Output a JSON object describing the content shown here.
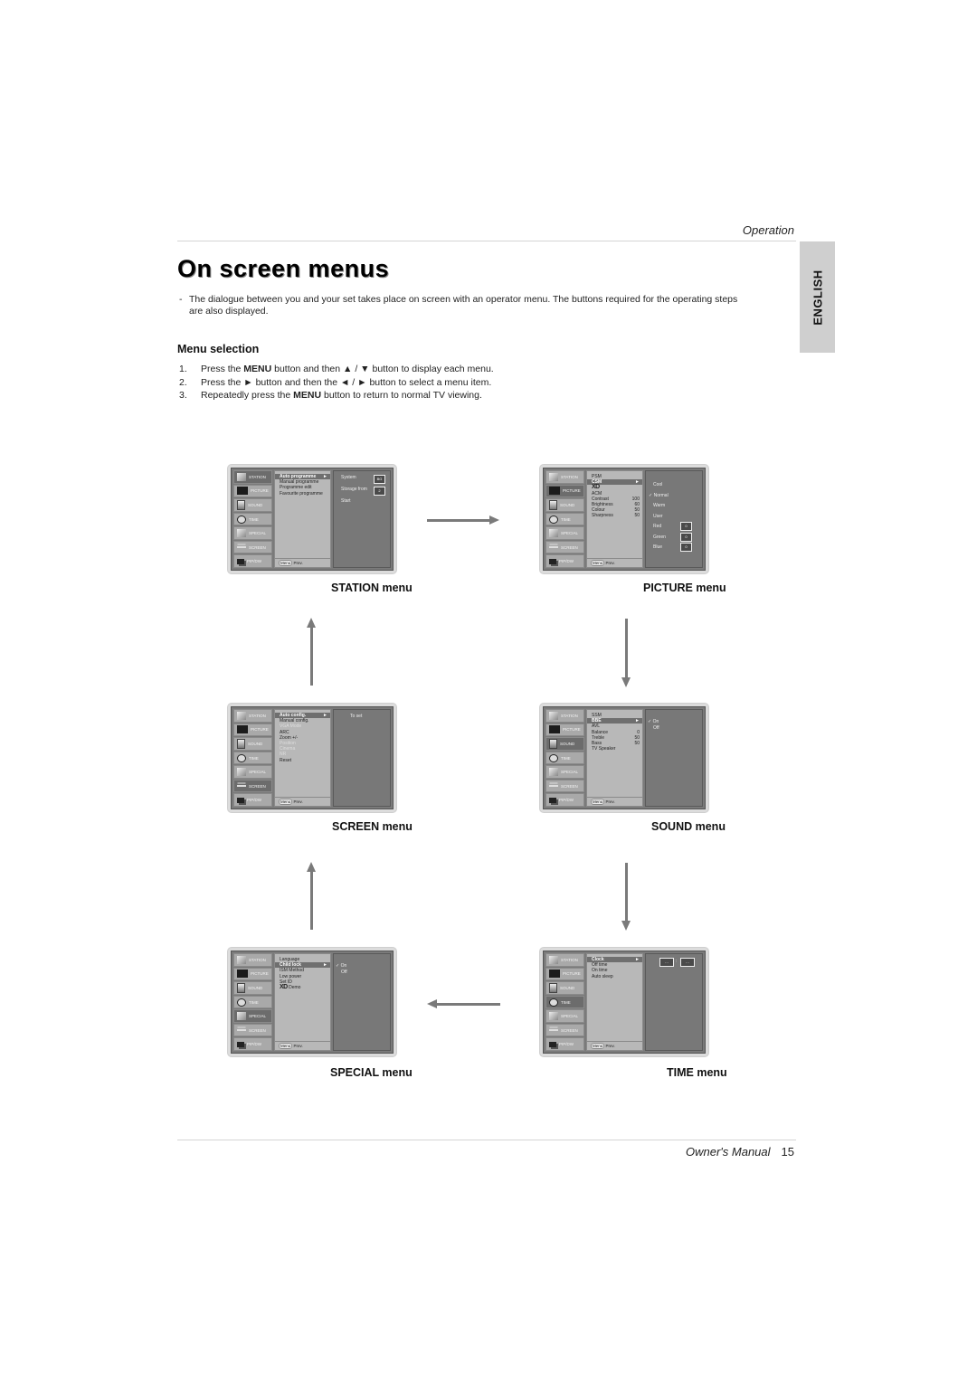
{
  "header": {
    "section": "Operation",
    "language_tab": "ENGLISH"
  },
  "title": "On screen menus",
  "intro": {
    "dash": "-",
    "text": "The dialogue between you and your set takes place on screen with an operator menu. The buttons required for the operating steps are also displayed."
  },
  "menu_selection": {
    "heading": "Menu selection",
    "steps": [
      {
        "num": "1.",
        "pre": "Press the ",
        "bold": "MENU",
        "post": " button and then ▲ / ▼ button to display each menu."
      },
      {
        "num": "2.",
        "pre": "Press the ► button and then the ◄ / ► button to select a menu item.",
        "bold": "",
        "post": ""
      },
      {
        "num": "3.",
        "pre": "Repeatedly press the ",
        "bold": "MENU",
        "post": " button to return to normal TV viewing."
      }
    ]
  },
  "tabs": [
    "STATION",
    "PICTURE",
    "SOUND",
    "TIME",
    "SPECIAL",
    "SCREEN",
    "PIP/DW"
  ],
  "footer_key": "Menu",
  "footer_text": "Prev.",
  "menus": {
    "station": {
      "caption": "STATION menu",
      "items": [
        "Auto programme",
        "Manual programme",
        "Programme edit",
        "Favourite programme"
      ],
      "right": [
        "System",
        "Storage from",
        "Start"
      ],
      "right_values": [
        "BG",
        "2"
      ]
    },
    "picture": {
      "caption": "PICTURE menu",
      "items": [
        "PSM",
        "CSM",
        "XD",
        "ACM",
        "Contrast",
        "Brightness",
        "Colour",
        "Sharpness"
      ],
      "item_values": [
        "",
        "",
        "",
        "",
        "100",
        "60",
        "50",
        "50"
      ],
      "right": [
        "Cool",
        "✓ Normal",
        "Warm",
        "User",
        "Red",
        "Green",
        "Blue"
      ],
      "right_values": [
        "0",
        "0",
        "0"
      ]
    },
    "screen": {
      "caption": "SCREEN menu",
      "items": [
        "Auto config.",
        "Manual config.",
        "VGA Mode",
        "ARC",
        "Zoom +/-",
        "Position",
        "Cinema",
        "NR",
        "Reset"
      ],
      "right": [
        "To set"
      ]
    },
    "sound": {
      "caption": "SOUND menu",
      "items": [
        "SSM",
        "BBE",
        "AVL",
        "Balance",
        "Treble",
        "Bass",
        "TV Speaker"
      ],
      "item_values": [
        "",
        "",
        "",
        "0",
        "50",
        "50",
        ""
      ],
      "right": [
        "✓ On",
        "Off"
      ]
    },
    "special": {
      "caption": "SPECIAL menu",
      "items": [
        "Language",
        "Child lock",
        "ISM Method",
        "Low power",
        "Set ID",
        "XD Demo"
      ],
      "right": [
        "✓ On",
        "Off"
      ]
    },
    "time": {
      "caption": "TIME menu",
      "items": [
        "Clock",
        "Off time",
        "On time",
        "Auto sleep"
      ],
      "right_values": [
        "- -",
        "- -"
      ],
      "separator": ":"
    }
  },
  "footer": {
    "label": "Owner's Manual",
    "page": "15"
  }
}
